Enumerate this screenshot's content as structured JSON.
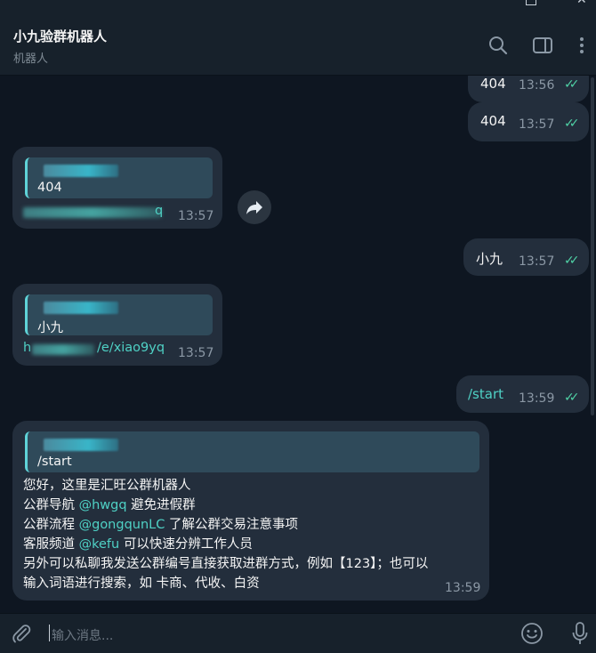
{
  "header": {
    "title": "小九验群机器人",
    "subtitle": "机器人"
  },
  "messages": {
    "out1": {
      "text": "404",
      "time": "13:56"
    },
    "out2": {
      "text": "404",
      "time": "13:57"
    },
    "in1": {
      "quote_text": "404",
      "link_tail": "q",
      "time": "13:57"
    },
    "out3": {
      "text": "小九",
      "time": "13:57"
    },
    "in2": {
      "quote_text": "小九",
      "link_head": "h",
      "link_tail": "/e/xiao9yq",
      "time": "13:57"
    },
    "out4": {
      "text": "/start",
      "time": "13:59"
    },
    "in3": {
      "quote_text": "/start",
      "line1": "您好，这里是汇旺公群机器人",
      "line2_a": "公群导航 ",
      "line2_link": "@hwgq",
      "line2_b": " 避免进假群",
      "line3_a": "公群流程 ",
      "line3_link": "@gongqunLC",
      "line3_b": " 了解公群交易注意事项",
      "line4_a": "客服频道 ",
      "line4_link": "@kefu",
      "line4_b": " 可以快速分辨工作人员",
      "line5": "另外可以私聊我发送公群编号直接获取进群方式，例如【123】；也可以",
      "line6": "输入词语进行搜索，如 卡商、代收、白资",
      "time": "13:59"
    }
  },
  "input": {
    "placeholder": "输入消息..."
  },
  "icons": {
    "search": "search-icon",
    "sidebar": "sidebar-toggle-icon",
    "more": "more-vertical-icon",
    "forward": "forward-icon",
    "attach": "paperclip-icon",
    "emoji": "emoji-icon",
    "mic": "microphone-icon"
  },
  "colors": {
    "link": "#4fd1c5",
    "read_ticks": "#4fd1a5",
    "bubble": "#232e3c",
    "background": "#0e1621"
  }
}
